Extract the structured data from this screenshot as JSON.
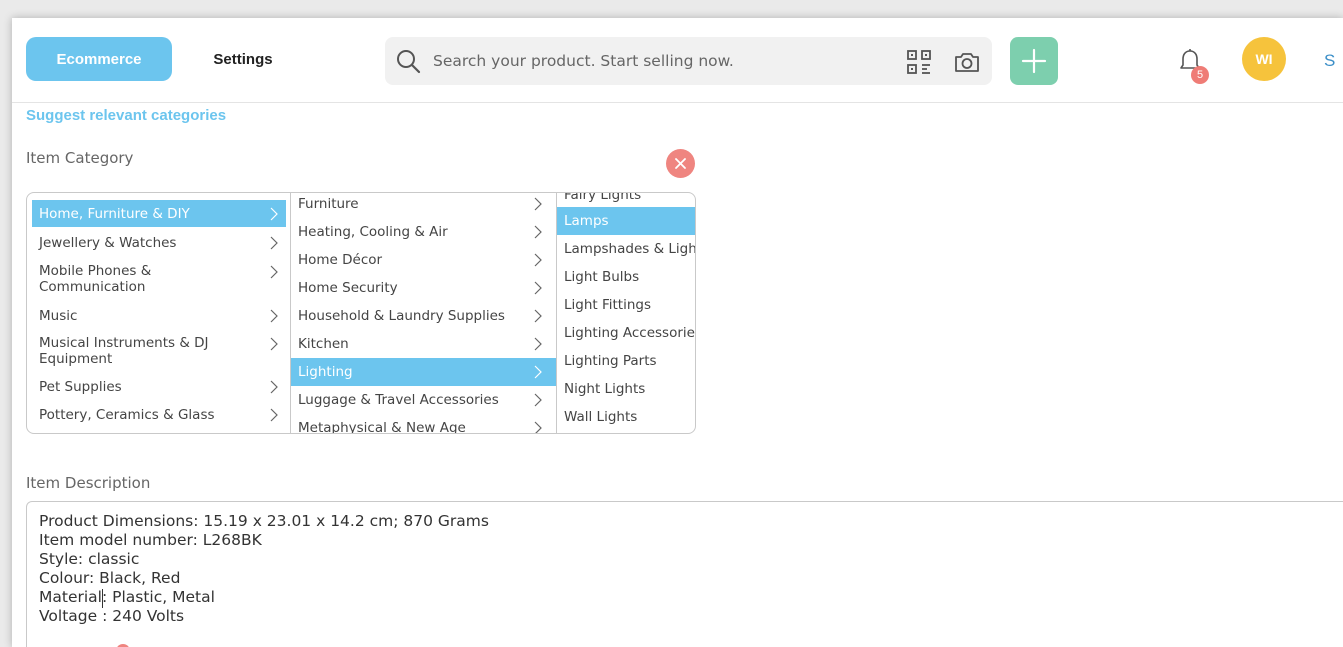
{
  "header": {
    "ecommerce_label": "Ecommerce",
    "settings_label": "Settings",
    "search_placeholder": "Search your product. Start selling now.",
    "notification_count": "5",
    "avatar_initials": "WI",
    "truncated_text": "S"
  },
  "form": {
    "suggest_link": "Suggest relevant categories",
    "category_label": "Item Category",
    "description_label": "Item Description"
  },
  "categories": {
    "level1": [
      {
        "label": "Home, Furniture & DIY",
        "selected": true
      },
      {
        "label": "Jewellery & Watches"
      },
      {
        "label": "Mobile Phones &\nCommunication"
      },
      {
        "label": "Music"
      },
      {
        "label": "Musical Instruments & DJ\nEquipment"
      },
      {
        "label": "Pet Supplies"
      },
      {
        "label": "Pottery, Ceramics & Glass"
      }
    ],
    "level2": [
      {
        "label": "Furniture"
      },
      {
        "label": "Heating, Cooling & Air"
      },
      {
        "label": "Home Décor"
      },
      {
        "label": "Home Security"
      },
      {
        "label": "Household & Laundry Supplies"
      },
      {
        "label": "Kitchen"
      },
      {
        "label": "Lighting",
        "selected": true
      },
      {
        "label": "Luggage & Travel Accessories"
      },
      {
        "label": "Metaphysical & New Age"
      }
    ],
    "level3": [
      {
        "label": "Fairy Lights"
      },
      {
        "label": "Lamps",
        "selected": true
      },
      {
        "label": "Lampshades & Light"
      },
      {
        "label": "Light Bulbs"
      },
      {
        "label": "Light Fittings"
      },
      {
        "label": "Lighting Accessories"
      },
      {
        "label": "Lighting Parts"
      },
      {
        "label": "Night Lights"
      },
      {
        "label": "Wall Lights"
      }
    ]
  },
  "description": {
    "lines": [
      "Product Dimensions: 15.19 x 23.01 x 14.2 cm; 870 Grams",
      "Item model number: L268BK",
      "Style: classic",
      "Colour: Black, Red",
      "Material: Plastic, Metal",
      "Voltage : 240 Volts"
    ]
  },
  "colors": {
    "accent": "#6cc5ee",
    "add_button": "#7dcfae",
    "avatar": "#f6c33c",
    "danger": "#ef8580"
  },
  "icons": [
    "search-icon",
    "qr-code-icon",
    "camera-icon",
    "plus-icon",
    "bell-icon",
    "close-icon",
    "chevron-right-icon"
  ]
}
